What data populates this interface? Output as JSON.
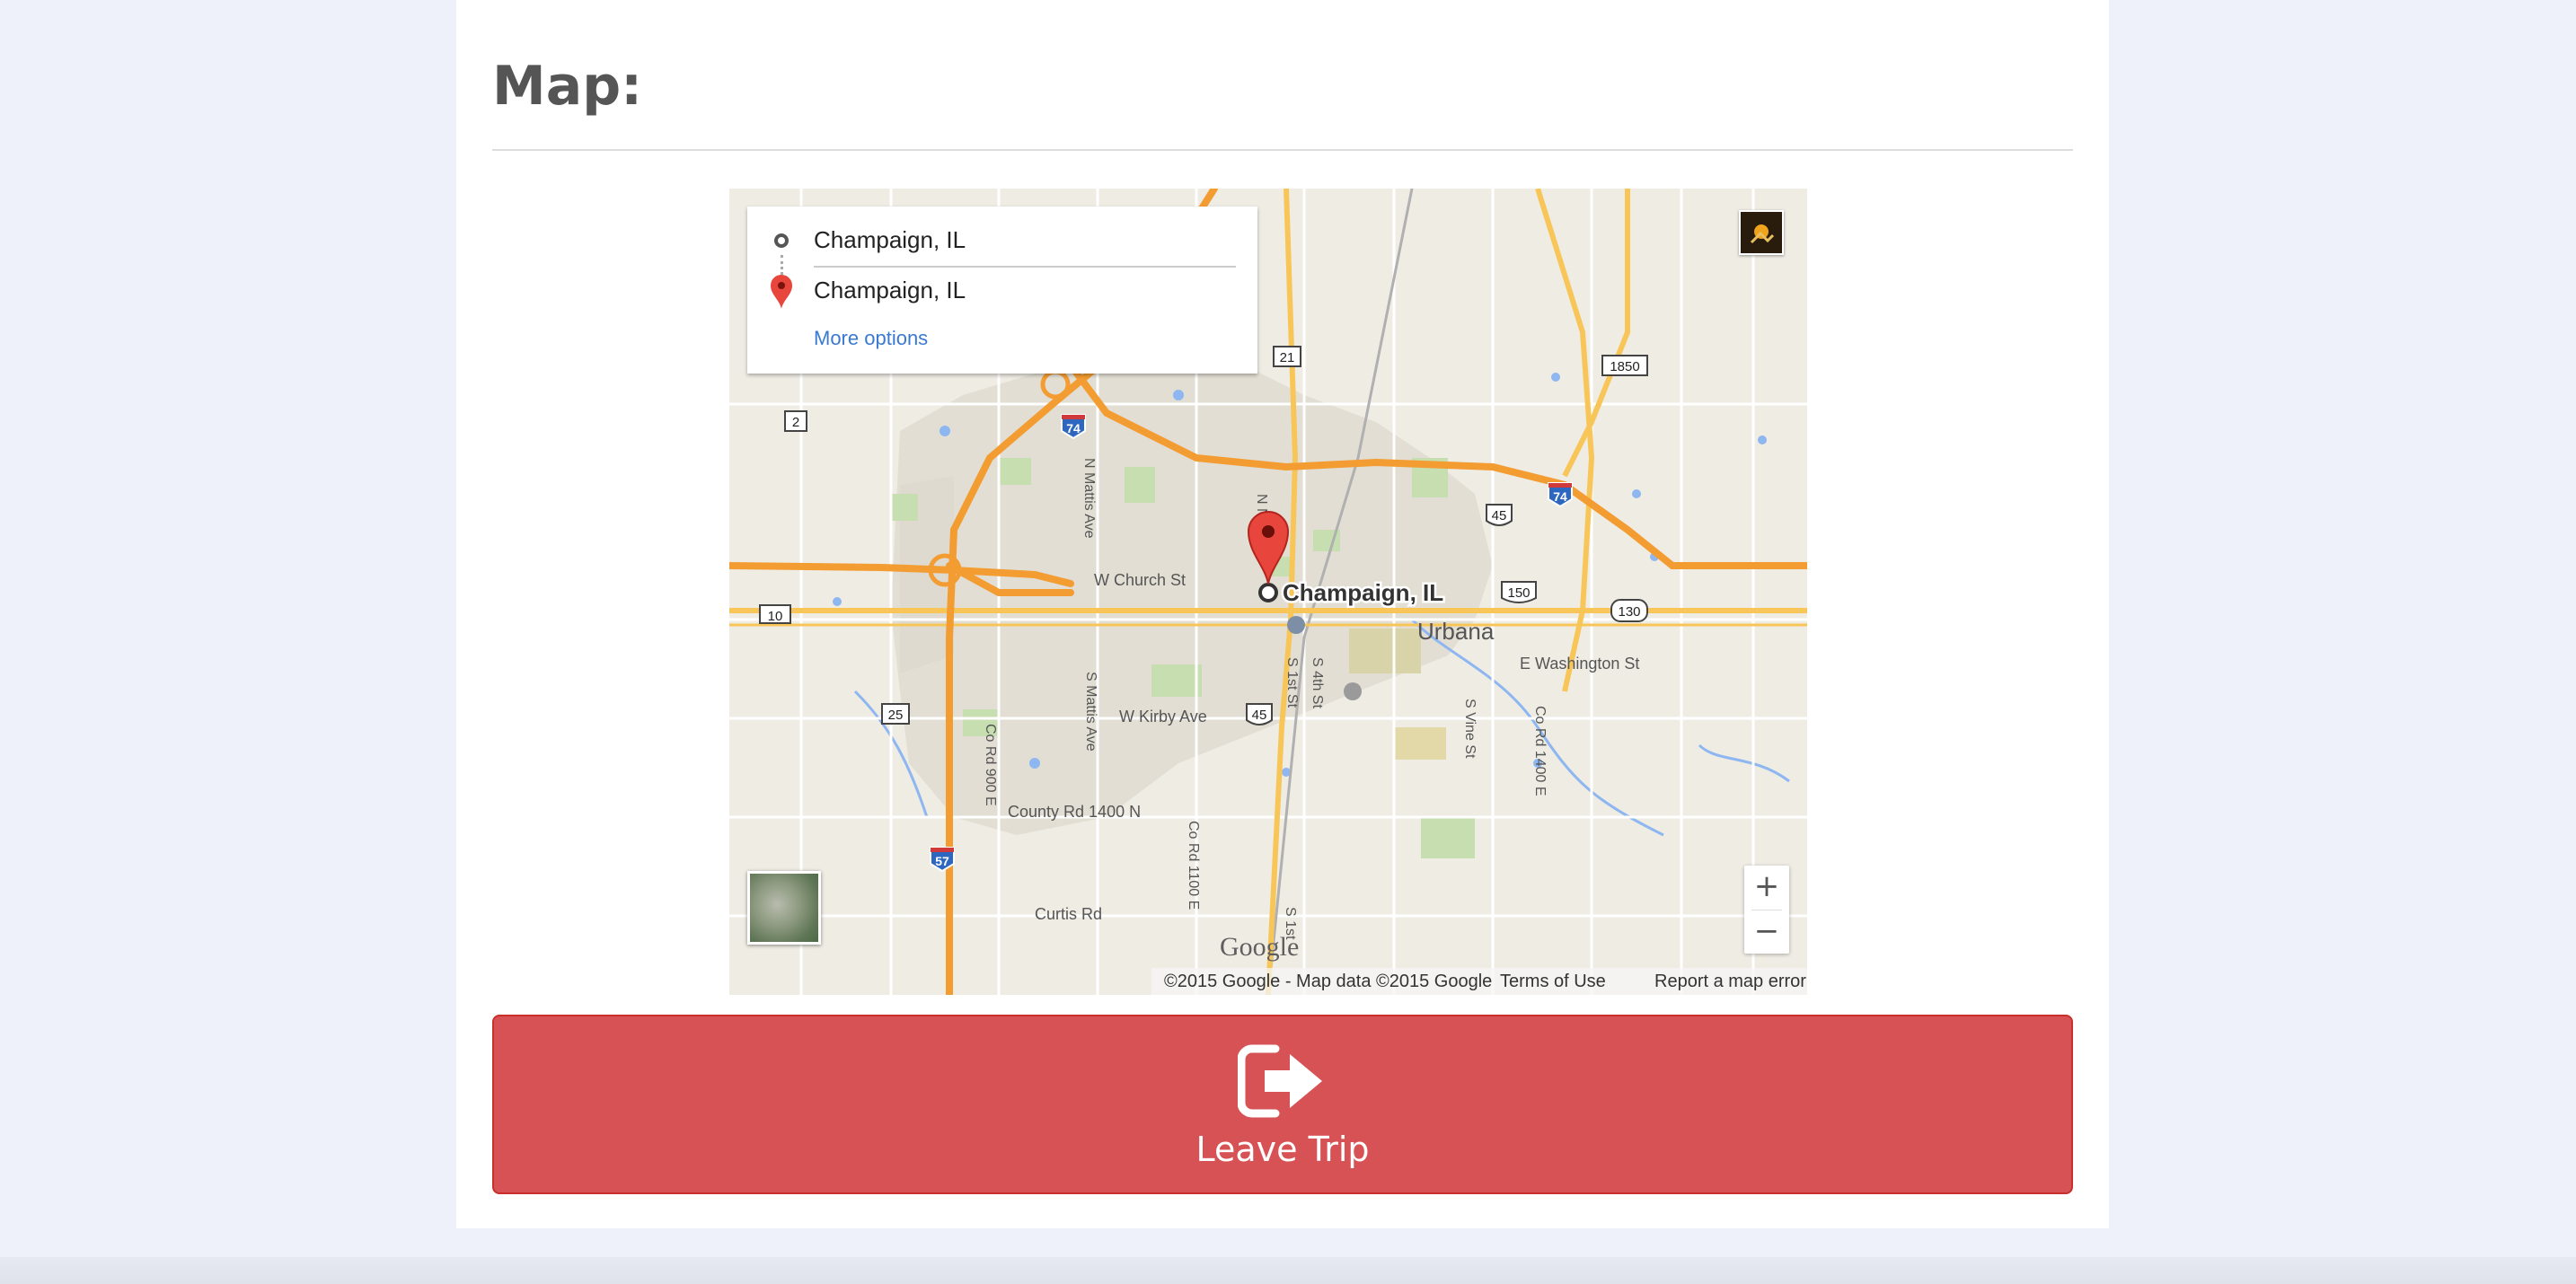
{
  "section": {
    "title": "Map:"
  },
  "map": {
    "directions": {
      "origin": "Champaign, IL",
      "destination": "Champaign, IL",
      "more_options": "More options"
    },
    "marker_label": "Champaign, IL",
    "places": {
      "urbana": "Urbana"
    },
    "streets": {
      "w_church_st": "W Church St",
      "w_kirby_ave": "W Kirby Ave",
      "e_washington_st": "E Washington St",
      "county_rd_1400n": "County Rd 1400 N",
      "curtis_rd": "Curtis Rd",
      "n_mattis_ave": "N Mattis Ave",
      "s_mattis_ave": "S Mattis Ave",
      "co_rd_900e": "Co Rd 900 E",
      "co_rd_1100e": "Co Rd 1100 E",
      "co_rd_1400e": "Co Rd 1400 E",
      "s_vine_st": "S Vine St",
      "s_1st_st": "S 1st St",
      "s_4th_st": "S 4th St",
      "n_n": "N N",
      "s_1st_bottom": "S 1st"
    },
    "shields": {
      "i74_west": "74",
      "i74_east": "74",
      "i57": "57",
      "us45_north": "45",
      "us45_south": "45",
      "us150": "150",
      "r21": "21",
      "r1850": "1850",
      "r2": "2",
      "r10": "10",
      "r25": "25",
      "r130": "130"
    },
    "logo": "Google",
    "attribution": {
      "copyright": "©2015 Google - Map data ©2015 Google",
      "terms": "Terms of Use",
      "report": "Report a map error"
    },
    "zoom": {
      "in": "+",
      "out": "−"
    },
    "colors": {
      "land": "#efece4",
      "highway": "#f39c32",
      "major_road": "#f8c658",
      "water": "#8eb6f0",
      "park": "#c6deb0",
      "marker": "#e8453c"
    }
  },
  "action": {
    "leave_label": "Leave Trip",
    "icon": "sign-out-icon",
    "color": "#d75254"
  }
}
